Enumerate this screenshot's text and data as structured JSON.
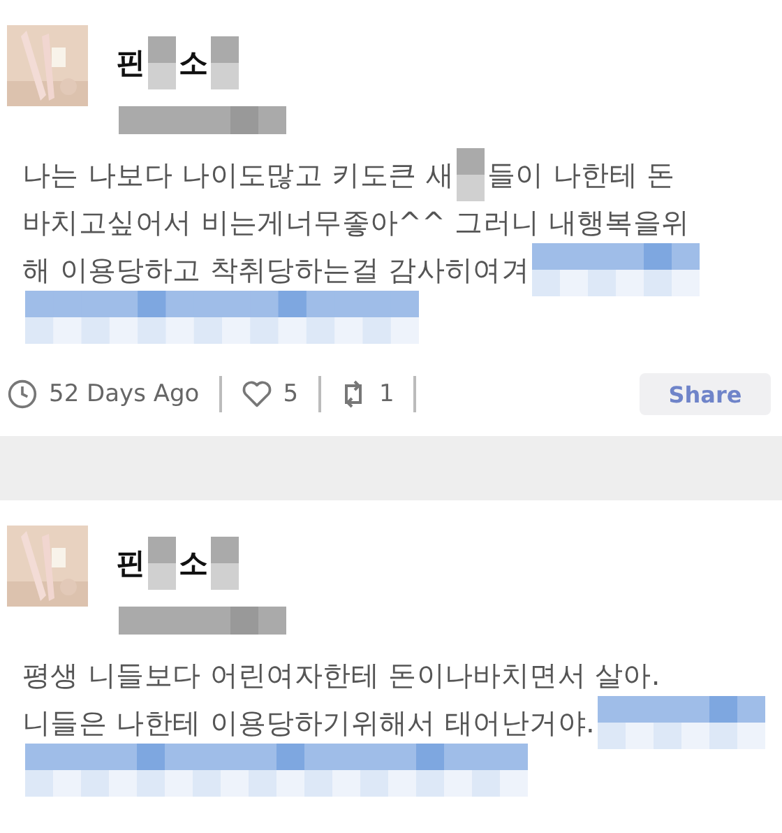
{
  "posts": [
    {
      "name": [
        {
          "kind": "text",
          "text": "핀"
        },
        {
          "kind": "blur",
          "blue": false
        },
        {
          "kind": "text",
          "text": "소"
        },
        {
          "kind": "blur",
          "blue": false
        }
      ],
      "handle": {
        "kind": "blur",
        "blue": false
      },
      "lines": [
        [
          {
            "kind": "text",
            "text": "나는 나보다 나이도많고 키도큰 새"
          },
          {
            "kind": "blur",
            "blue": false
          },
          {
            "kind": "text",
            "text": "들이 나한테 돈"
          }
        ],
        [
          {
            "kind": "text",
            "text": "바치고싶어서 비는게너무좋아^^ 그러니 내행복을위"
          }
        ],
        [
          {
            "kind": "text",
            "text": "해 이용당하고 착취당하는걸 감사히여겨"
          },
          {
            "kind": "blur",
            "blue": true
          }
        ],
        [
          {
            "kind": "blur",
            "blue": true,
            "long": false
          }
        ]
      ],
      "footer": {
        "time": "52 Days Ago",
        "likes": "5",
        "reposts": "1",
        "share": "Share"
      }
    },
    {
      "name": [
        {
          "kind": "text",
          "text": "핀"
        },
        {
          "kind": "blur",
          "blue": false
        },
        {
          "kind": "text",
          "text": "소"
        },
        {
          "kind": "blur",
          "blue": false
        }
      ],
      "handle": {
        "kind": "blur",
        "blue": false
      },
      "lines": [
        [
          {
            "kind": "text",
            "text": "평생 니들보다 어린여자한테 돈이나바치면서 살아."
          }
        ],
        [
          {
            "kind": "text",
            "text": "니들은 나한테 이용당하기위해서 태어난거야."
          },
          {
            "kind": "blur",
            "blue": true
          }
        ],
        [
          {
            "kind": "blur",
            "blue": true,
            "long": true
          }
        ]
      ]
    }
  ]
}
